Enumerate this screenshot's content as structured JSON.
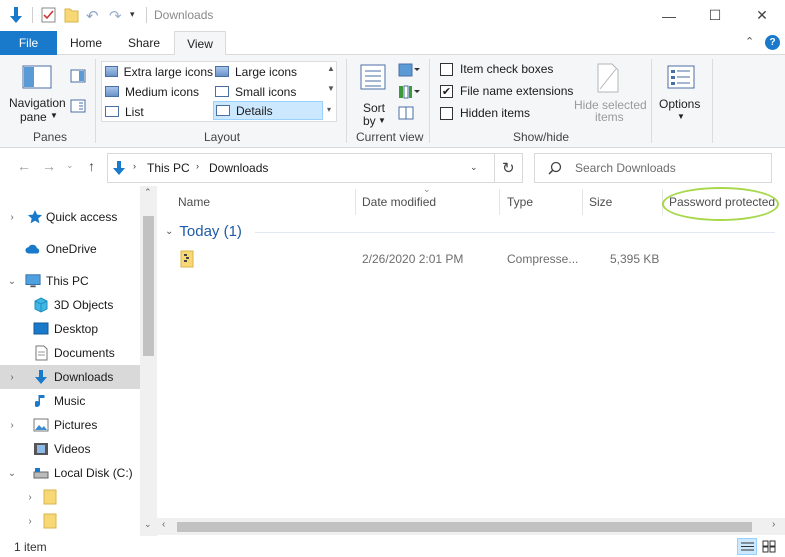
{
  "window": {
    "title": "Downloads",
    "controls": {
      "minimize": "—",
      "maximize": "☐",
      "close": "✕"
    }
  },
  "ribbon_tabs": [
    "File",
    "Home",
    "Share",
    "View"
  ],
  "ribbon": {
    "panes": {
      "navigation_pane": [
        "Navigation",
        "pane"
      ],
      "group": "Panes"
    },
    "layout": {
      "items": [
        "Extra large icons",
        "Large icons",
        "Medium icons",
        "Small icons",
        "List",
        "Details"
      ],
      "selected": "Details",
      "group": "Layout"
    },
    "current_view": {
      "sort_by": [
        "Sort",
        "by"
      ],
      "group": "Current view"
    },
    "show_hide": {
      "checkboxes": [
        {
          "label": "Item check boxes",
          "checked": false
        },
        {
          "label": "File name extensions",
          "checked": true
        },
        {
          "label": "Hidden items",
          "checked": false
        }
      ],
      "hide_selected": [
        "Hide selected",
        "items"
      ],
      "group": "Show/hide"
    },
    "options": "Options"
  },
  "address": {
    "path": [
      "This PC",
      "Downloads"
    ],
    "search_placeholder": "Search Downloads"
  },
  "nav": [
    {
      "label": "Quick access",
      "icon": "star-icon",
      "chevron": "›"
    },
    {
      "label": "OneDrive",
      "icon": "cloud-icon",
      "chevron": ""
    },
    {
      "label": "This PC",
      "icon": "computer-icon",
      "chevron": "⌄"
    },
    {
      "label": "3D Objects",
      "icon": "cube-icon",
      "chevron": ""
    },
    {
      "label": "Desktop",
      "icon": "desktop-icon",
      "chevron": ""
    },
    {
      "label": "Documents",
      "icon": "document-icon",
      "chevron": ""
    },
    {
      "label": "Downloads",
      "icon": "download-icon",
      "chevron": "›"
    },
    {
      "label": "Music",
      "icon": "music-icon",
      "chevron": ""
    },
    {
      "label": "Pictures",
      "icon": "pictures-icon",
      "chevron": "›"
    },
    {
      "label": "Videos",
      "icon": "video-icon",
      "chevron": ""
    },
    {
      "label": "Local Disk (C:)",
      "icon": "drive-icon",
      "chevron": "⌄"
    },
    {
      "label": "",
      "icon": "folder-icon",
      "chevron": "›"
    },
    {
      "label": "",
      "icon": "folder-icon",
      "chevron": "›"
    }
  ],
  "columns": [
    "Name",
    "Date modified",
    "Type",
    "Size",
    "Password protected"
  ],
  "groups": [
    {
      "header": "Today (1)",
      "files": [
        {
          "name": "",
          "date": "2/26/2020 2:01 PM",
          "type": "Compresse...",
          "size": "5,395 KB",
          "icon": "zip-folder-icon"
        }
      ]
    }
  ],
  "status": {
    "count": "1 item"
  },
  "colors": {
    "accent": "#1979ca",
    "selection": "#cce8ff",
    "annotation": "#a6d84a",
    "group_header": "#1e5aa8"
  }
}
